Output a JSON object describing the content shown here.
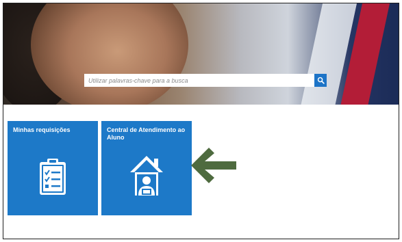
{
  "search": {
    "placeholder": "Utilizar palavras-chave para a busca"
  },
  "tiles": [
    {
      "title": "Minhas requisições",
      "icon": "clipboard-checklist-icon"
    },
    {
      "title": "Central de Atendimento ao Aluno",
      "icon": "house-person-icon"
    }
  ],
  "colors": {
    "tile": "#1d79c8",
    "search_button": "#1d74c7",
    "arrow": "#4e6b3f"
  },
  "annotation": {
    "icon": "arrow-left-icon"
  }
}
